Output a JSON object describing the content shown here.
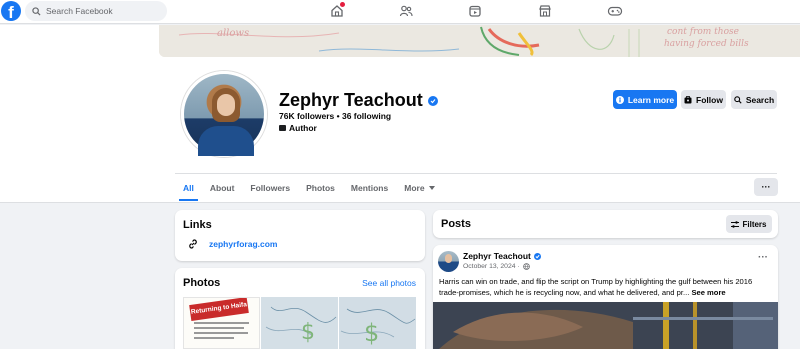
{
  "topbar": {
    "logo": "f",
    "search_placeholder": "Search Facebook",
    "icons": [
      "home-icon",
      "friends-icon",
      "video-icon",
      "marketplace-icon",
      "gaming-icon"
    ]
  },
  "cover": {
    "scribbles": [
      "allows",
      "cont from those",
      "having forced bills"
    ]
  },
  "profile": {
    "name": "Zephyr Teachout",
    "stats": "76K followers • 36 following",
    "category": "Author"
  },
  "actions": {
    "learn_more": "Learn more",
    "follow": "Follow",
    "search": "Search"
  },
  "tabs": [
    "All",
    "About",
    "Followers",
    "Photos",
    "Mentions",
    "More"
  ],
  "links_card": {
    "title": "Links",
    "url": "zephyrforag.com"
  },
  "photos_card": {
    "title": "Photos",
    "see_all": "See all photos",
    "first_photo_caption": "Returning to Haifa"
  },
  "posts_card": {
    "title": "Posts",
    "filters": "Filters"
  },
  "post": {
    "author": "Zephyr Teachout",
    "date": "October 13, 2024 ·",
    "text": "Harris can win on trade, and flip the script on Trump by highlighting the gulf between his 2016 trade-promises, which he is recycling now, and what he delivered, and pr...",
    "see_more": "See more"
  },
  "colors": {
    "brand": "#1877f2",
    "background": "#f0f2f5",
    "text": "#050505",
    "secondary_text": "#65676b"
  }
}
